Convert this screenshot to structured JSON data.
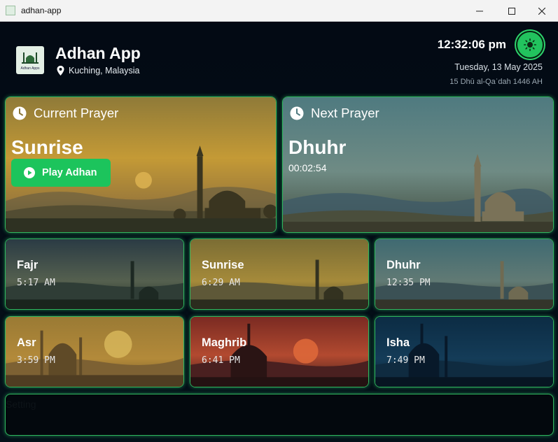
{
  "window": {
    "title": "adhan-app"
  },
  "header": {
    "app_title": "Adhan App",
    "logo_caption": "Adhan Apps",
    "location": "Kuching, Malaysia",
    "clock": "12:32:06 pm",
    "gregorian_date": "Tuesday, 13 May 2025",
    "hijri_date": "15 Dhū al-Qaʿdah 1446 AH"
  },
  "current": {
    "header": "Current Prayer",
    "name": "Sunrise",
    "button_label": "Play Adhan"
  },
  "next": {
    "header": "Next Prayer",
    "name": "Dhuhr",
    "countdown": "00:02:54"
  },
  "prayers": [
    {
      "name": "Fajr",
      "time": "5:17 AM"
    },
    {
      "name": "Sunrise",
      "time": "6:29 AM"
    },
    {
      "name": "Dhuhr",
      "time": "12:35 PM"
    },
    {
      "name": "Asr",
      "time": "3:59 PM"
    },
    {
      "name": "Maghrib",
      "time": "6:41 PM"
    },
    {
      "name": "Isha",
      "time": "7:49 PM"
    }
  ],
  "settings": {
    "label": "Setting"
  },
  "colors": {
    "accent": "#22c35e",
    "border": "#2fb75e",
    "background": "#050b14"
  }
}
